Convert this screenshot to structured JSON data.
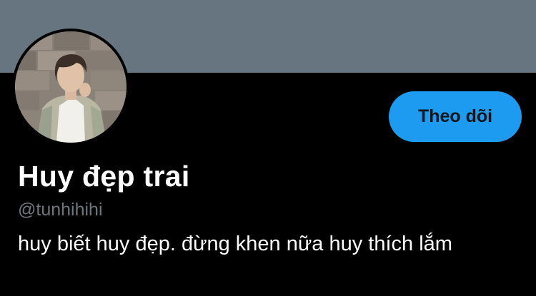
{
  "profile": {
    "display_name": "Huy đẹp trai",
    "handle": "@tunhihihi",
    "bio": "huy biết huy đẹp. đừng khen nữa huy thích lắm",
    "follow_label": "Theo dõi"
  },
  "colors": {
    "banner": "#66757f",
    "background": "#000000",
    "accent": "#1d9bf0",
    "handle_text": "#6e767d",
    "primary_text": "#ffffff"
  },
  "icons": {
    "avatar": "profile-photo"
  }
}
